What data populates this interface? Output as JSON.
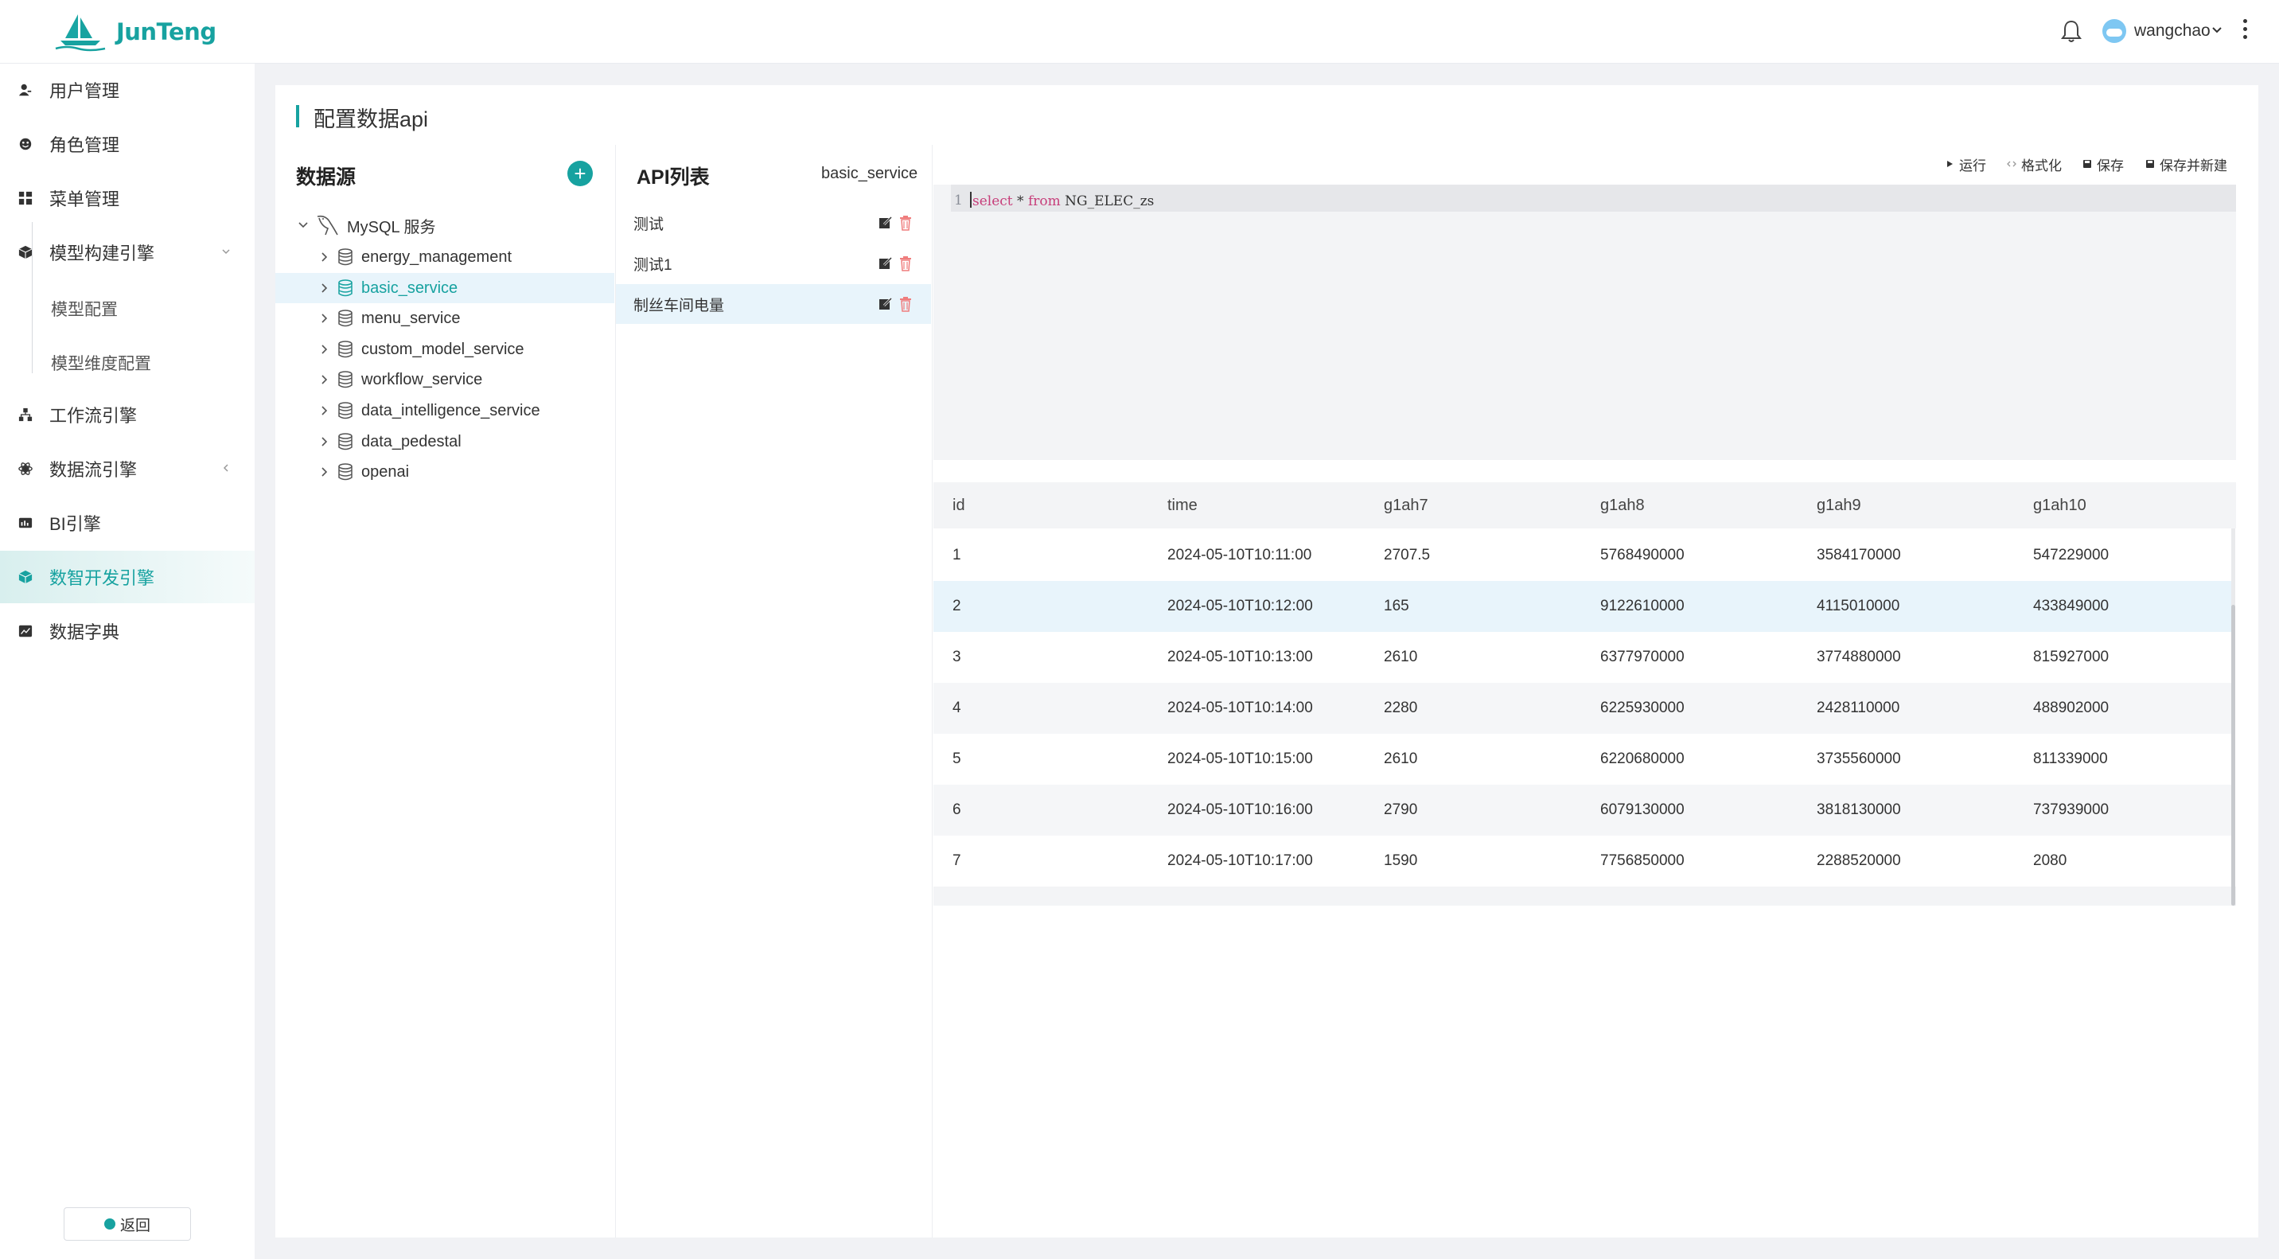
{
  "app": {
    "logo_text": "JunTeng",
    "brand_color": "#17a2a0"
  },
  "header": {
    "username": "wangchao"
  },
  "sidebar": {
    "items": [
      {
        "label": "用户管理",
        "icon": "user-icon"
      },
      {
        "label": "角色管理",
        "icon": "role-icon"
      },
      {
        "label": "菜单管理",
        "icon": "menu-grid-icon"
      },
      {
        "label": "模型构建引擎",
        "icon": "cube-icon"
      },
      {
        "label": "工作流引擎",
        "icon": "workflow-icon"
      },
      {
        "label": "数据流引擎",
        "icon": "dataflow-icon"
      },
      {
        "label": "BI引擎",
        "icon": "bi-icon"
      },
      {
        "label": "数智开发引擎",
        "icon": "dev-icon"
      },
      {
        "label": "数据字典",
        "icon": "dictionary-icon"
      }
    ],
    "submenu": [
      {
        "label": "模型配置"
      },
      {
        "label": "模型维度配置"
      }
    ],
    "back_label": "返回"
  },
  "page": {
    "title": "配置数据api"
  },
  "datasource": {
    "title": "数据源",
    "root_label": "MySQL 服务",
    "databases": [
      "energy_management",
      "basic_service",
      "menu_service",
      "custom_model_service",
      "workflow_service",
      "data_intelligence_service",
      "data_pedestal",
      "openai"
    ],
    "selected": "basic_service"
  },
  "api_list": {
    "title": "API列表",
    "service": "basic_service",
    "items": [
      "测试",
      "测试1",
      "制丝车间电量"
    ],
    "selected": "制丝车间电量"
  },
  "toolbar": {
    "run": "运行",
    "format": "格式化",
    "save": "保存",
    "save_new": "保存并新建"
  },
  "editor": {
    "line_number": "1",
    "kw_select": "select",
    "op_star": " * ",
    "kw_from": "from",
    "table": " NG_ELEC_zs"
  },
  "results": {
    "columns": [
      "id",
      "time",
      "g1ah7",
      "g1ah8",
      "g1ah9",
      "g1ah10"
    ],
    "rows": [
      [
        "1",
        "2024-05-10T10:11:00",
        "2707.5",
        "5768490000",
        "3584170000",
        "547229000"
      ],
      [
        "2",
        "2024-05-10T10:12:00",
        "165",
        "9122610000",
        "4115010000",
        "433849000"
      ],
      [
        "3",
        "2024-05-10T10:13:00",
        "2610",
        "6377970000",
        "3774880000",
        "815927000"
      ],
      [
        "4",
        "2024-05-10T10:14:00",
        "2280",
        "6225930000",
        "2428110000",
        "488902000"
      ],
      [
        "5",
        "2024-05-10T10:15:00",
        "2610",
        "6220680000",
        "3735560000",
        "811339000"
      ],
      [
        "6",
        "2024-05-10T10:16:00",
        "2790",
        "6079130000",
        "3818130000",
        "737939000"
      ],
      [
        "7",
        "2024-05-10T10:17:00",
        "1590",
        "7756850000",
        "2288520000",
        "2080"
      ]
    ]
  }
}
